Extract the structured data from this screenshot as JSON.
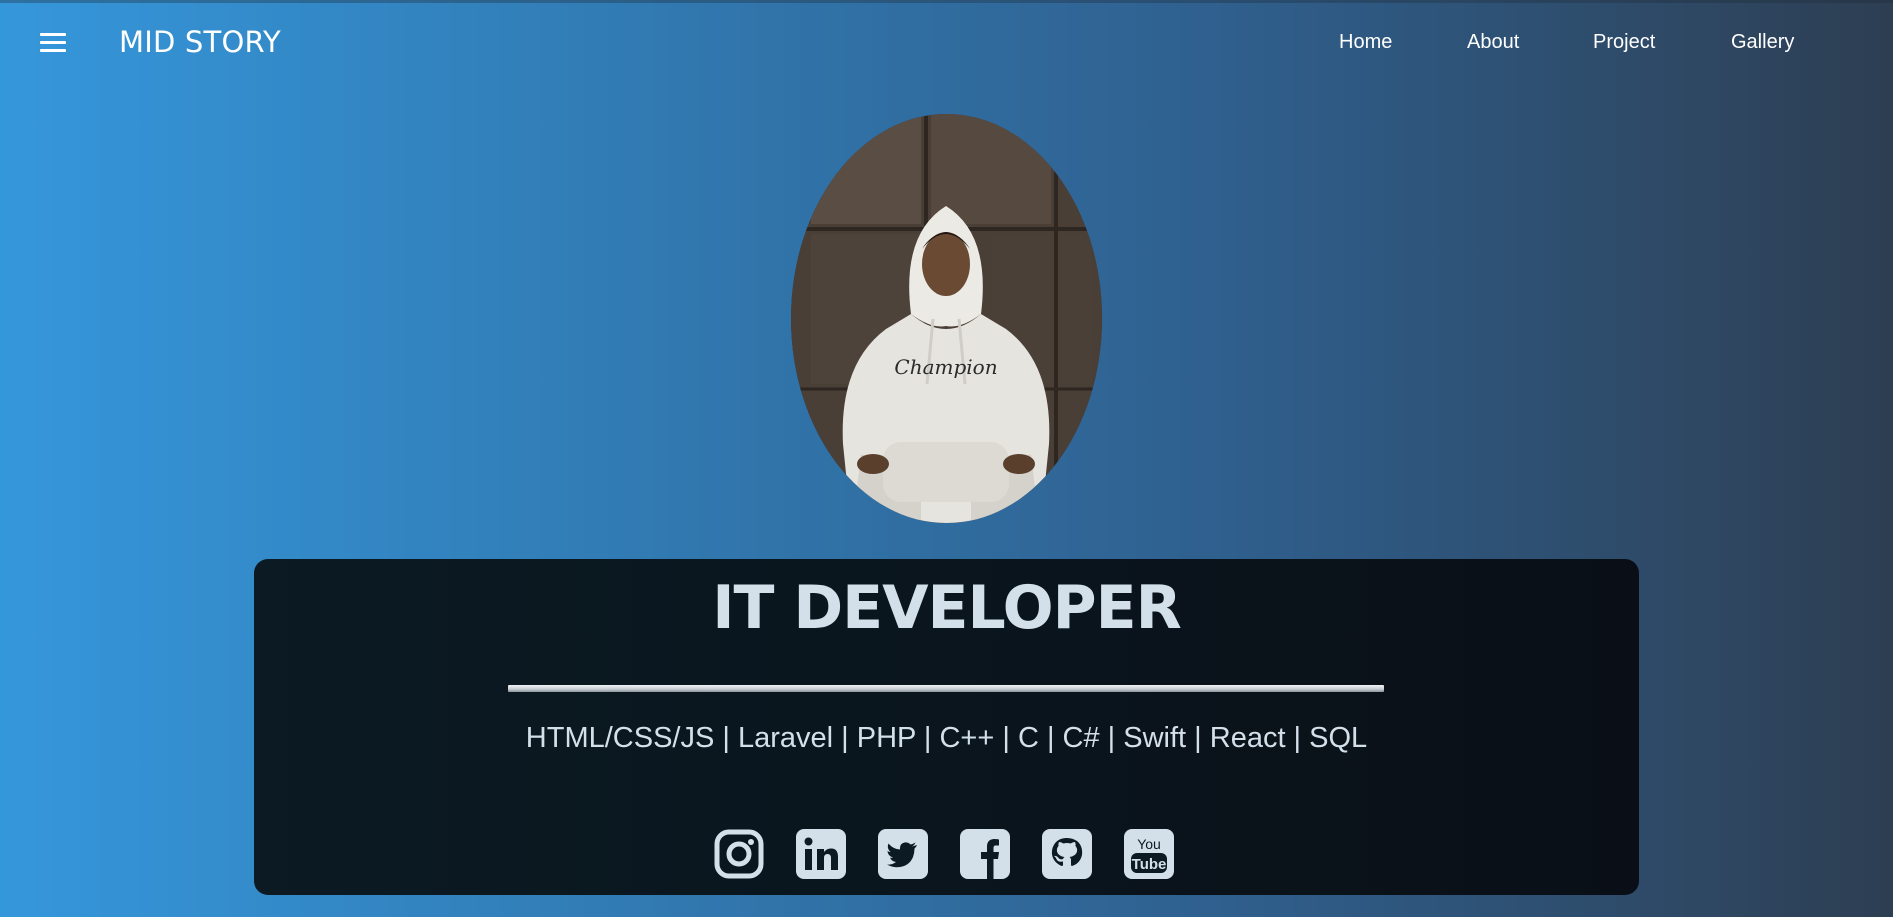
{
  "colors": {
    "bg_gradient": [
      "#3597db",
      "#3179b1",
      "#2f5f8d",
      "#2d3e52"
    ],
    "card_bg": "#0b1a23",
    "card_text": "#d3e0ea",
    "nav_text": "#ffffff"
  },
  "navbar": {
    "menu_icon": "hamburger-menu-icon",
    "brand": "MID STORY",
    "links": [
      {
        "label": "Home"
      },
      {
        "label": "About"
      },
      {
        "label": "Project"
      },
      {
        "label": "Gallery"
      }
    ]
  },
  "hero": {
    "portrait_subject": "person in white hoodie against brown wall"
  },
  "card": {
    "title": "IT DEVELOPER",
    "skills": "HTML/CSS/JS | Laravel | PHP | C++ | C | C# | Swift | React | SQL",
    "social": [
      {
        "icon": "instagram-icon"
      },
      {
        "icon": "linkedin-icon"
      },
      {
        "icon": "twitter-icon"
      },
      {
        "icon": "facebook-icon"
      },
      {
        "icon": "github-icon"
      },
      {
        "icon": "youtube-icon"
      }
    ]
  }
}
